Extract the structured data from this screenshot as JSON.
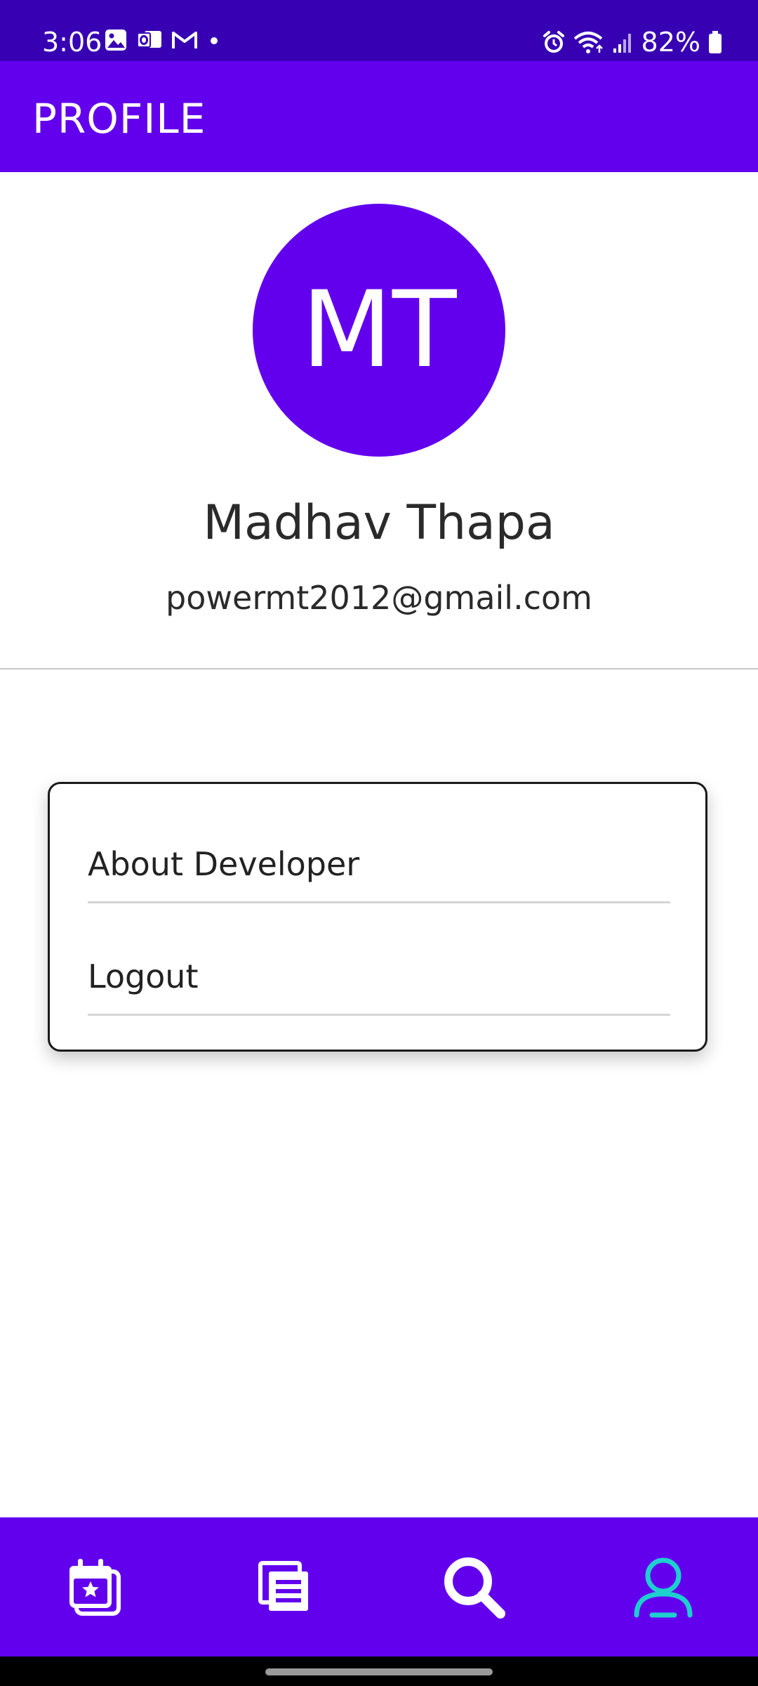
{
  "status_bar": {
    "time": "3:06",
    "battery": "82%",
    "icons_left": [
      "gallery-icon",
      "outlook-icon",
      "gmail-icon",
      "dot-icon"
    ],
    "icons_right": [
      "alarm-icon",
      "wifi-icon",
      "signal-icon",
      "battery-icon"
    ]
  },
  "app_bar": {
    "title": "PROFILE"
  },
  "profile": {
    "initials": "MT",
    "name": "Madhav Thapa",
    "email": "powermt2012@gmail.com"
  },
  "menu": {
    "items": [
      {
        "label": "About Developer"
      },
      {
        "label": "Logout"
      }
    ]
  },
  "bottom_nav": {
    "items": [
      {
        "icon": "calendar-star-icon",
        "active": false
      },
      {
        "icon": "news-icon",
        "active": false
      },
      {
        "icon": "search-icon",
        "active": false
      },
      {
        "icon": "profile-icon",
        "active": true
      }
    ]
  },
  "colors": {
    "status_bar": "#3700b3",
    "primary": "#6200ee",
    "active_icon": "#1ecfcf",
    "inactive_icon": "#ffffff"
  }
}
